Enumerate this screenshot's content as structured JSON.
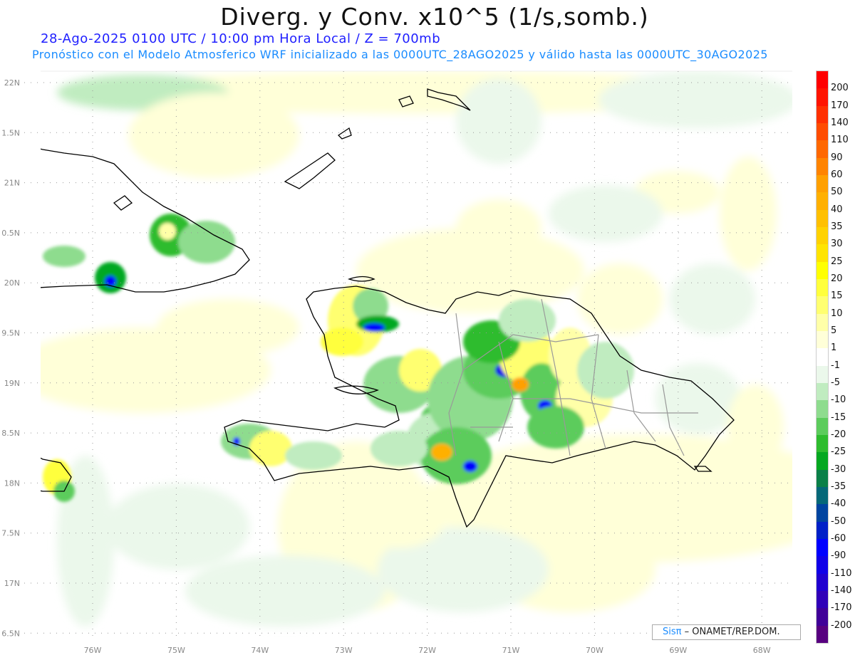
{
  "header": {
    "title": "Diverg. y Conv. x10^5 (1/s,somb.)",
    "subtitle": "28-Ago-2025  0100 UTC / 10:00 pm Hora Local / Z = 700mb",
    "forecast_note": "Pronóstico con el Modelo Atmosferico WRF inicializado a las 0000UTC_28AGO2025 y válido hasta las  0000UTC_30AGO2025"
  },
  "axes": {
    "lon_labels": [
      "76W",
      "75W",
      "74W",
      "73W",
      "72W",
      "71W",
      "70W",
      "69W",
      "68W"
    ],
    "lat_labels": [
      "22N",
      "1.5N",
      "21N",
      "0.5N",
      "20N",
      "9.5N",
      "19N",
      "8.5N",
      "18N",
      "7.5N",
      "17N",
      "6.5N"
    ]
  },
  "colorbar": {
    "labels": [
      "200",
      "170",
      "140",
      "110",
      "90",
      "60",
      "50",
      "40",
      "35",
      "30",
      "25",
      "20",
      "15",
      "10",
      "5",
      "1",
      "-1",
      "-5",
      "-10",
      "-15",
      "-20",
      "-25",
      "-30",
      "-35",
      "-40",
      "-50",
      "-60",
      "-90",
      "-110",
      "-140",
      "-170",
      "-200"
    ],
    "colors": [
      "#ff0000",
      "#ff1400",
      "#ff3000",
      "#ff4c00",
      "#ff6800",
      "#ff8400",
      "#ffa000",
      "#ffb000",
      "#ffc000",
      "#ffd200",
      "#ffe400",
      "#ffff00",
      "#ffff3c",
      "#ffff70",
      "#ffffa8",
      "#ffffd8",
      "#ffffff",
      "#ebf8eb",
      "#c0ecc0",
      "#8edc8e",
      "#5ccc5c",
      "#2ebc2e",
      "#04a820",
      "#0a8048",
      "#056878",
      "#0044a0",
      "#0020c8",
      "#0000ff",
      "#1000e8",
      "#2000d0",
      "#3000b8",
      "#400098",
      "#580080"
    ]
  },
  "credit": {
    "brand": "Sisπ",
    "text": " –  ONAMET/REP.DOM."
  }
}
